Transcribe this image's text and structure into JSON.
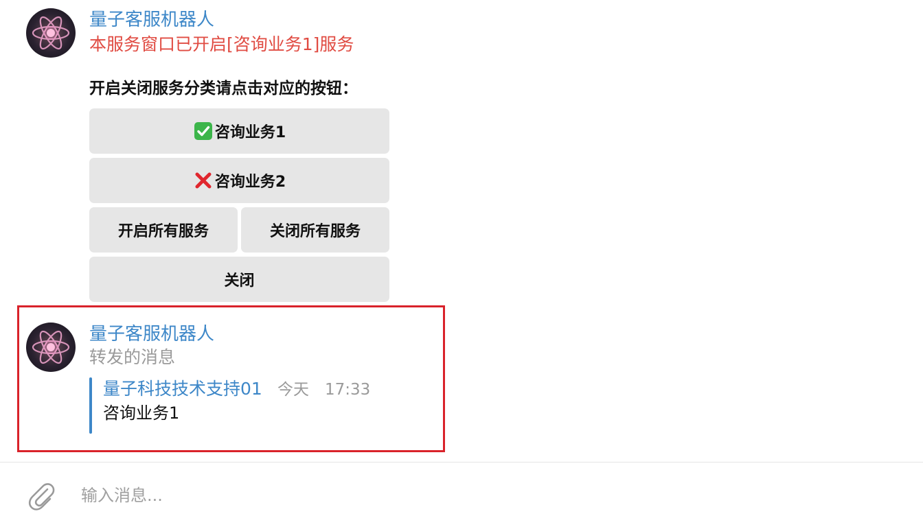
{
  "message1": {
    "sender": "量子客服机器人",
    "status": "本服务窗口已开启[咨询业务1]服务",
    "prompt": "开启关闭服务分类请点击对应的按钮：",
    "buttons": {
      "service1": {
        "glyph": "✅",
        "label": "咨询业务1"
      },
      "service2": {
        "glyph": "❌",
        "label": "咨询业务2"
      },
      "open_all": "开启所有服务",
      "close_all": "关闭所有服务",
      "close": "关闭"
    }
  },
  "message2": {
    "sender": "量子客服机器人",
    "subtitle": "转发的消息",
    "forwarded": {
      "from": "量子科技技术支持01",
      "date": "今天",
      "time": "17:33",
      "text": "咨询业务1"
    }
  },
  "composer": {
    "placeholder": "输入消息..."
  },
  "colors": {
    "link_blue": "#3d87c8",
    "alert_red": "#e04b42",
    "highlight_border": "#d9222a",
    "button_bg": "#e6e6e6"
  },
  "icons": {
    "avatar": "atom-avatar-icon",
    "attach": "paperclip-icon"
  }
}
